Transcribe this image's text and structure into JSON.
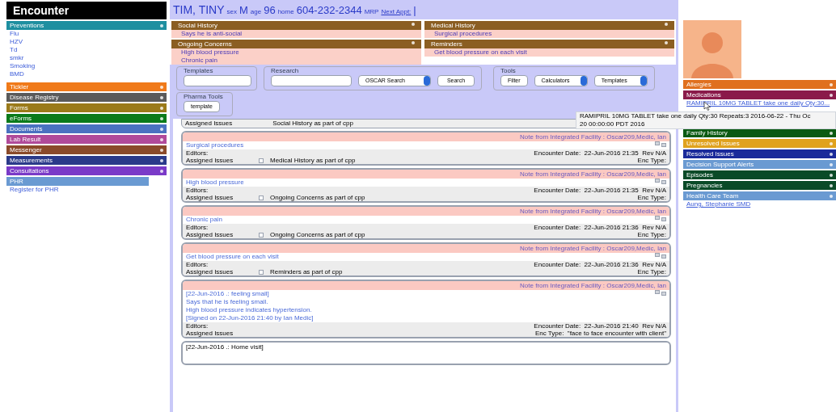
{
  "sidebar": {
    "title": "Encounter",
    "sections": [
      {
        "title": "Preventions",
        "color": "#1e8fa0",
        "items": [
          "Flu",
          "HZV",
          "Td",
          "smkr",
          "Smoking",
          "BMD"
        ]
      },
      {
        "title": "Tickler",
        "color": "#f07a1a"
      },
      {
        "title": "Disease Registry",
        "color": "#5a5a5a"
      },
      {
        "title": "Forms",
        "color": "#9a7a1a"
      },
      {
        "title": "eForms",
        "color": "#0a7a1a"
      },
      {
        "title": "Documents",
        "color": "#4a72c0"
      },
      {
        "title": "Lab Result",
        "color": "#b04a9a"
      },
      {
        "title": "Messenger",
        "color": "#8a4a2a"
      },
      {
        "title": "Measurements",
        "color": "#2a3a8a"
      },
      {
        "title": "Consultations",
        "color": "#7a3ac8"
      }
    ],
    "phr": {
      "title": "PHR",
      "link": "Register for PHR"
    }
  },
  "patient_header": [
    {
      "kind": "name",
      "text": "TIM, TINY"
    },
    {
      "kind": "label",
      "text": "sex"
    },
    {
      "kind": "value",
      "text": "M"
    },
    {
      "kind": "label",
      "text": "age"
    },
    {
      "kind": "value",
      "text": "96"
    },
    {
      "kind": "label",
      "text": "home"
    },
    {
      "kind": "value",
      "text": "604-232-2344"
    },
    {
      "kind": "label",
      "text": "MRP"
    },
    {
      "kind": "link",
      "text": "Next Appt:"
    },
    {
      "kind": "value",
      "text": "|"
    }
  ],
  "cpp": [
    {
      "title": "Social History",
      "items": [
        "Says he is anti-social"
      ]
    },
    {
      "title": "Medical History",
      "items": [
        "Surgical procedures"
      ]
    },
    {
      "title": "Ongoing Concerns",
      "items": [
        "High blood pressure",
        "Chronic pain"
      ]
    },
    {
      "title": "Reminders",
      "items": [
        "Get blood pressure on each visit"
      ]
    }
  ],
  "tools": {
    "templates": {
      "legend": "Templates"
    },
    "research": {
      "legend": "Research",
      "select": "OSCAR Search",
      "button": "Search"
    },
    "tools": {
      "legend": "Tools",
      "button": "Filter",
      "selects": [
        "Calculators",
        "Templates"
      ]
    },
    "pharma": {
      "legend": "Pharma Tools",
      "button": "template"
    }
  },
  "notes": [
    {
      "kind": "partial",
      "assigned": "Assigned Issues",
      "issue": "Social History as part of cpp"
    },
    {
      "kind": "note",
      "header": "Note from Integrated Facility : Oscar209,Medic, Ian",
      "lines": [
        "Surgical procedures"
      ],
      "editors": "Editors:",
      "encounter": "Encounter Date:  22-Jun-2016 21:35  Rev N/A",
      "assigned": "Assigned Issues",
      "issue": "Medical History as part of cpp",
      "issue_checked": false,
      "enc_type": "Enc Type:"
    },
    {
      "kind": "note",
      "header": "Note from Integrated Facility : Oscar209,Medic, Ian",
      "lines": [
        "High blood pressure"
      ],
      "editors": "Editors:",
      "encounter": "Encounter Date:  22-Jun-2016 21:35  Rev N/A",
      "assigned": "Assigned Issues",
      "issue": "Ongoing Concerns as part of cpp",
      "issue_checked": false,
      "enc_type": "Enc Type:"
    },
    {
      "kind": "note",
      "header": "Note from Integrated Facility : Oscar209,Medic, Ian",
      "lines": [
        "Chronic pain"
      ],
      "editors": "Editors:",
      "encounter": "Encounter Date:  22-Jun-2016 21:36  Rev N/A",
      "assigned": "Assigned Issues",
      "issue": "Ongoing Concerns as part of cpp",
      "issue_checked": false,
      "enc_type": "Enc Type:"
    },
    {
      "kind": "note",
      "header": "Note from Integrated Facility : Oscar209,Medic, Ian",
      "lines": [
        "Get blood pressure on each visit"
      ],
      "editors": "Editors:",
      "encounter": "Encounter Date:  22-Jun-2016 21:36  Rev N/A",
      "assigned": "Assigned Issues",
      "issue": "Reminders as part of cpp",
      "issue_checked": false,
      "enc_type": "Enc Type:"
    },
    {
      "kind": "note",
      "header": "Note from Integrated Facility : Oscar209,Medic, Ian",
      "lines": [
        "[22-Jun-2016 .: feeling small]",
        "Says that he is feeling small.",
        "High blood pressure indicates hypertension.",
        "[Signed on 22-Jun-2016 21:40 by Ian Medic]"
      ],
      "editors": "Editors:",
      "encounter": "Encounter Date:  22-Jun-2016 21:40  Rev N/A",
      "assigned": "Assigned Issues",
      "enc_type": "Enc Type:  \"face to face encounter with client\""
    },
    {
      "kind": "editing",
      "text": "[22-Jun-2016 .: Home visit]"
    }
  ],
  "right_panel": {
    "sections": [
      {
        "title": "Allergies",
        "color": "#e0701e"
      },
      {
        "title": "Medications",
        "color": "#8a1a4a",
        "items": [
          "RAMIPRIL 10MG TABLET take one daily Qty:30..."
        ]
      },
      {
        "title": "Family History",
        "color": "#0a5a12"
      },
      {
        "title": "Unresolved Issues",
        "color": "#e0a21e"
      },
      {
        "title": "Resolved Issues",
        "color": "#1a2a9a"
      },
      {
        "title": "Decision Support Alerts",
        "color": "#6a9ad2"
      },
      {
        "title": "Episodes",
        "color": "#0a4a28"
      },
      {
        "title": "Pregnancies",
        "color": "#0a4a28"
      },
      {
        "title": "Health Care Team",
        "color": "#6a9ad2",
        "items": [
          "Aung, Stephanie SMD"
        ]
      }
    ],
    "tooltip": [
      "RAMIPRIL 10MG TABLET  take one daily  Qty:30 Repeats:3 2016-06-22 - Thu Oc",
      "20 00:00:00 PDT 2016"
    ]
  }
}
